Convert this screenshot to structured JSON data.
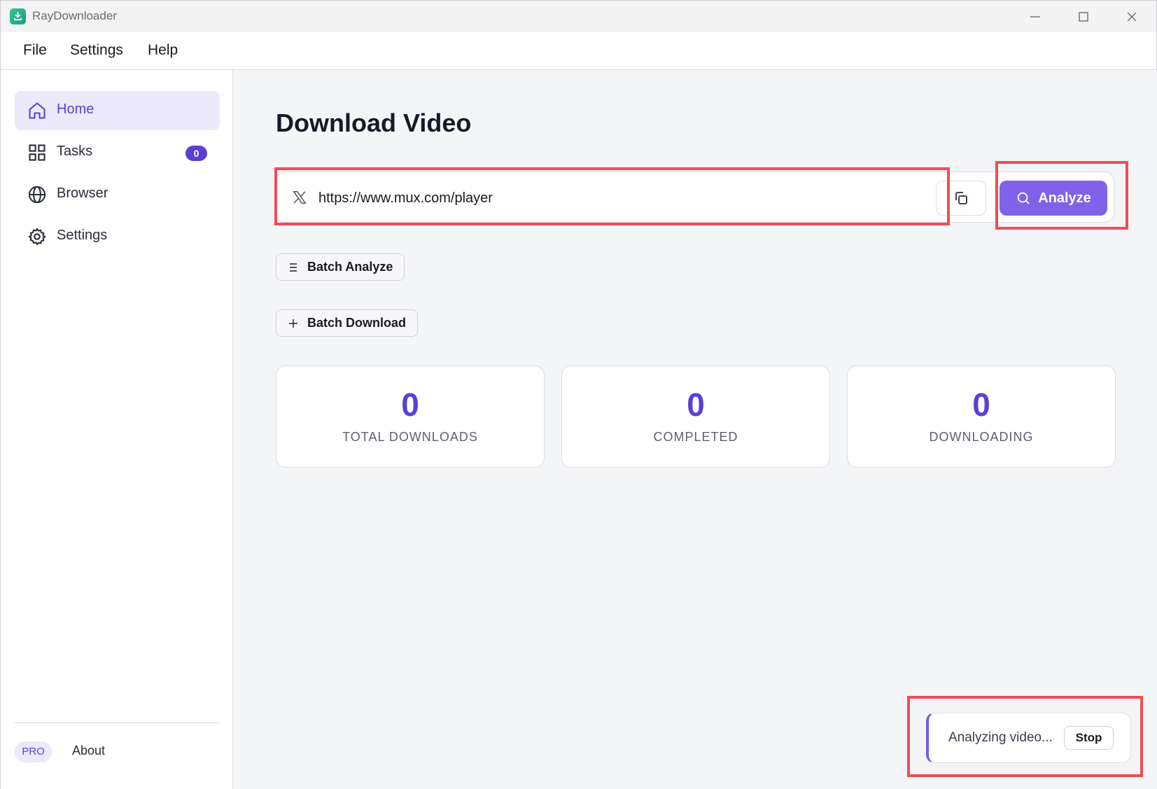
{
  "window": {
    "title": "RayDownloader",
    "controls": [
      "minimize",
      "maximize",
      "close"
    ]
  },
  "menubar": {
    "items": [
      "File",
      "Settings",
      "Help"
    ]
  },
  "sidebar": {
    "items": [
      {
        "label": "Home",
        "icon": "home-icon",
        "active": true
      },
      {
        "label": "Tasks",
        "icon": "grid-icon",
        "badge": "0"
      },
      {
        "label": "Browser",
        "icon": "globe-icon"
      },
      {
        "label": "Settings",
        "icon": "gear-icon"
      }
    ],
    "pro_label": "PRO",
    "about_label": "About"
  },
  "main": {
    "title": "Download Video",
    "url_input": {
      "value": "https://www.mux.com/player",
      "platform_icon": "x-logo-icon"
    },
    "paste_icon": "copy-icon",
    "analyze_label": "Analyze",
    "batch_analyze_label": "Batch Analyze",
    "batch_download_label": "Batch Download",
    "stats": [
      {
        "value": "0",
        "label": "TOTAL DOWNLOADS"
      },
      {
        "value": "0",
        "label": "COMPLETED"
      },
      {
        "value": "0",
        "label": "DOWNLOADING"
      }
    ]
  },
  "toast": {
    "message": "Analyzing video...",
    "stop_label": "Stop"
  },
  "colors": {
    "accent": "#5b3fd6",
    "button": "#8062e8",
    "annotation": "#ec4f55"
  }
}
